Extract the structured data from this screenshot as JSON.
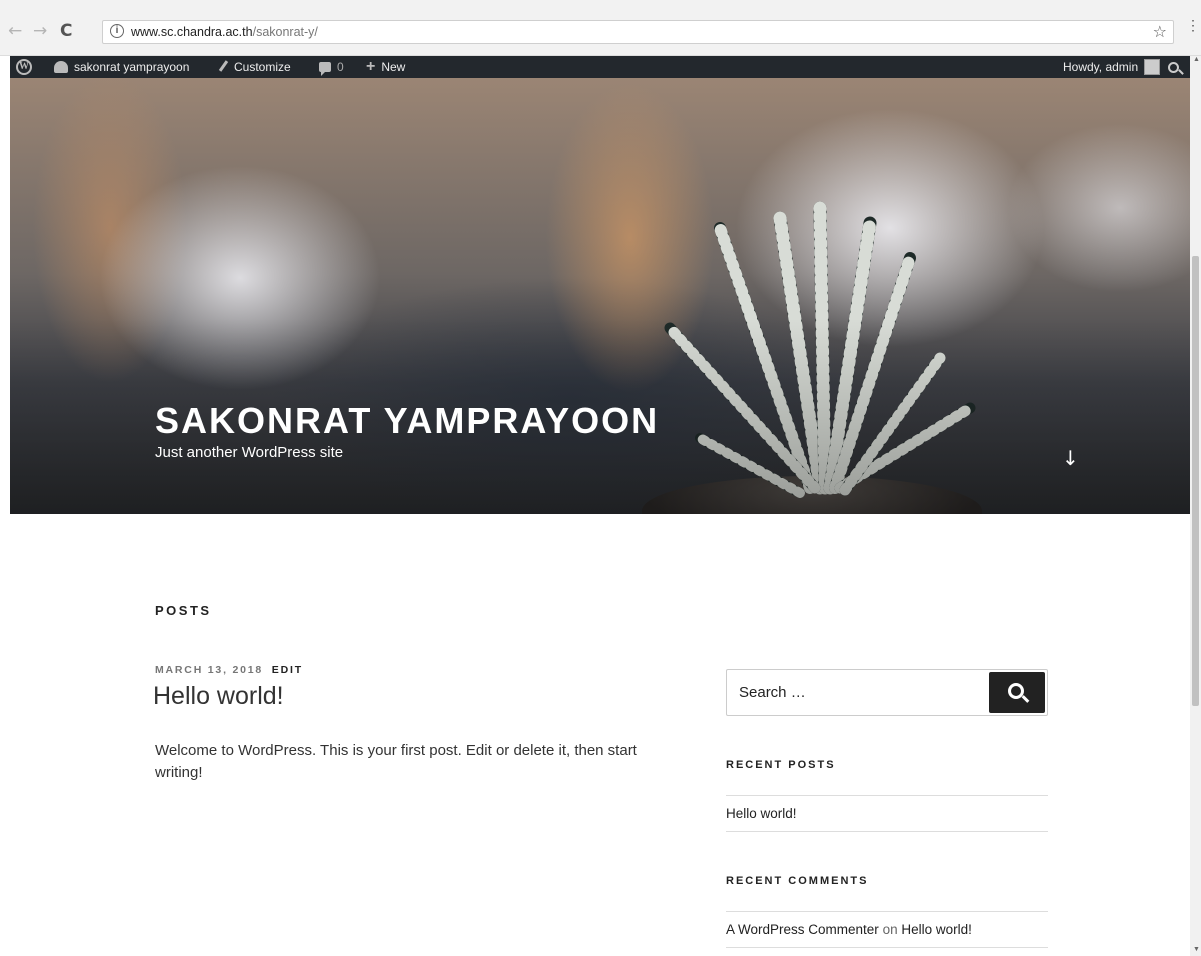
{
  "browser": {
    "back": "←",
    "forward": "→",
    "reload": "C",
    "url_host": "www.sc.chandra.ac.th",
    "url_path": "/sakonrat-y/",
    "star": "☆",
    "menu": "⋮"
  },
  "adminbar": {
    "site_name": "sakonrat yamprayoon",
    "customize": "Customize",
    "comments_count": "0",
    "new_label": "New",
    "howdy": "Howdy, admin"
  },
  "header": {
    "site_title": "SAKONRAT YAMPRAYOON",
    "tagline": "Just another WordPress site",
    "scroll_arrow": "↓"
  },
  "main": {
    "section_heading": "POSTS",
    "post": {
      "date": "MARCH 13, 2018",
      "edit_label": "EDIT",
      "title": "Hello world!",
      "excerpt": "Welcome to WordPress. This is your first post. Edit or delete it, then start writing!"
    }
  },
  "sidebar": {
    "search_placeholder": "Search …",
    "recent_posts_title": "RECENT POSTS",
    "recent_posts": [
      "Hello world!"
    ],
    "recent_comments_title": "RECENT COMMENTS",
    "recent_comment": {
      "author": "A WordPress Commenter",
      "on": "on",
      "post": "Hello world!"
    }
  }
}
